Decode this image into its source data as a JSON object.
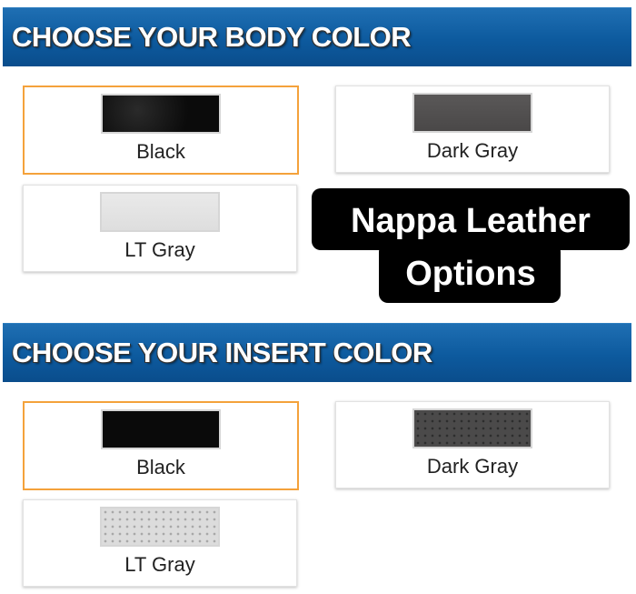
{
  "body_section": {
    "title": "CHOOSE YOUR BODY COLOR",
    "options": [
      {
        "label": "Black",
        "selected": true,
        "color": "#0b0b0b"
      },
      {
        "label": "Dark Gray",
        "selected": false,
        "color": "#4f4d4d"
      },
      {
        "label": "LT Gray",
        "selected": false,
        "color": "#e3e3e3"
      }
    ]
  },
  "overlay": {
    "line1": "Nappa Leather",
    "line2": "Options"
  },
  "insert_section": {
    "title": "CHOOSE YOUR INSERT COLOR",
    "options": [
      {
        "label": "Black",
        "selected": true,
        "color": "#0a0a0a"
      },
      {
        "label": "Dark Gray",
        "selected": false,
        "color": "#4b4a4a"
      },
      {
        "label": "LT Gray",
        "selected": false,
        "color": "#dcdcdc"
      }
    ]
  },
  "colors": {
    "banner": "#0d5a9e",
    "selected_border": "#f4a23b"
  }
}
